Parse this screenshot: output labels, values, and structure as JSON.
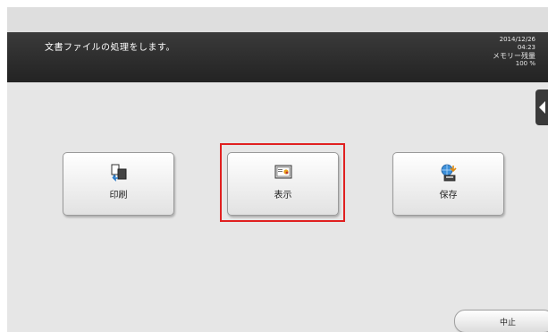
{
  "header": {
    "message": "文書ファイルの処理をします。",
    "date": "2014/12/26",
    "time": "04:23",
    "memory_label": "メモリー残量",
    "memory_value": "100 %"
  },
  "actions": {
    "print_label": "印刷",
    "view_label": "表示",
    "save_label": "保存"
  },
  "footer": {
    "stop_label": "中止"
  },
  "colors": {
    "highlight": "#e02020",
    "header_bg": "#2a2a2a"
  },
  "icons": {
    "print": "print-icon",
    "view": "display-icon",
    "save": "save-icon",
    "side": "side-tab-arrow-icon"
  }
}
